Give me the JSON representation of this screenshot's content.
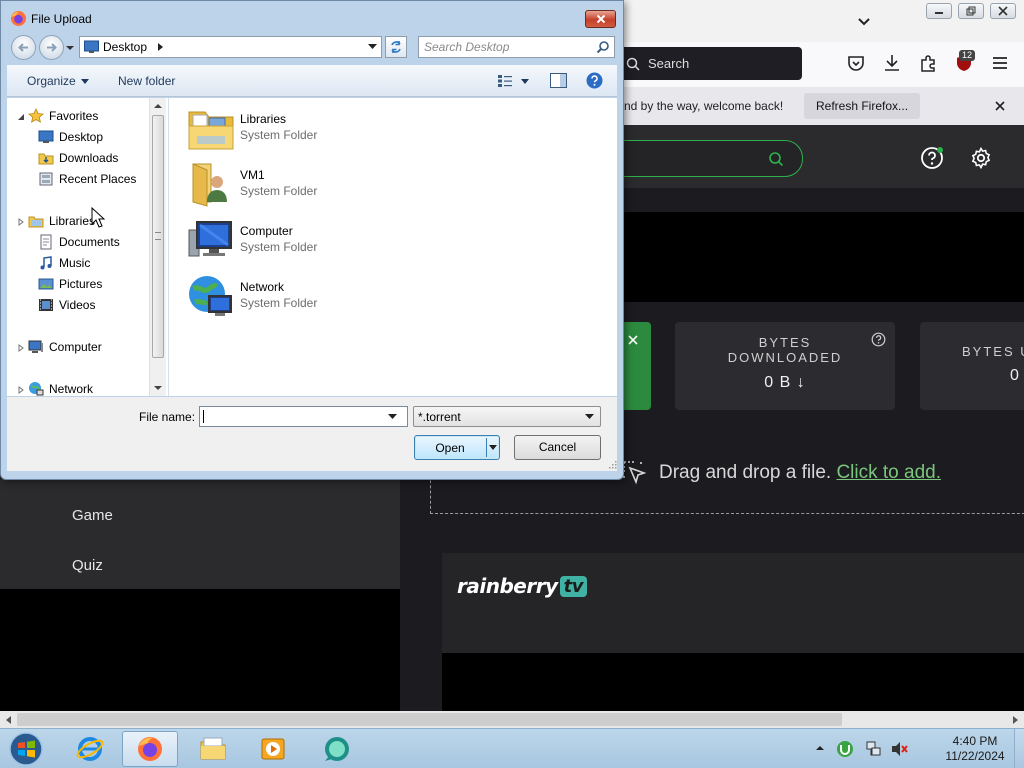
{
  "firefox": {
    "search_placeholder": "Search",
    "extension_badge": "12",
    "notification_text": "nd by the way, welcome back!",
    "refresh_button": "Refresh Firefox..."
  },
  "webpage": {
    "stats": {
      "downloaded_label": "BYTES DOWNLOADED",
      "downloaded_value": "0 B ↓",
      "uploaded_label": "BYTES U",
      "uploaded_value": "0"
    },
    "drop_text": "Drag and drop a file.",
    "drop_link": "Click to add.",
    "menu": [
      "Game",
      "Quiz"
    ],
    "logo_text": "rainberry",
    "logo_tv": "tv",
    "accent_green": "#2bb24c",
    "link_green": "#7bc67e"
  },
  "dialog": {
    "title": "File Upload",
    "address": {
      "location": "Desktop"
    },
    "search_placeholder": "Search Desktop",
    "toolbar": {
      "organize": "Organize",
      "new_folder": "New folder"
    },
    "nav_tree": {
      "favorites": "Favorites",
      "favorites_items": [
        "Desktop",
        "Downloads",
        "Recent Places"
      ],
      "libraries": "Libraries",
      "libraries_items": [
        "Documents",
        "Music",
        "Pictures",
        "Videos"
      ],
      "computer": "Computer",
      "network": "Network"
    },
    "files": [
      {
        "name": "Libraries",
        "type": "System Folder",
        "icon": "libraries-folder-icon"
      },
      {
        "name": "VM1",
        "type": "System Folder",
        "icon": "user-folder-icon"
      },
      {
        "name": "Computer",
        "type": "System Folder",
        "icon": "computer-icon"
      },
      {
        "name": "Network",
        "type": "System Folder",
        "icon": "network-globe-icon"
      }
    ],
    "file_name_label": "File name:",
    "file_name_value": "",
    "file_type": "*.torrent",
    "open_button": "Open",
    "cancel_button": "Cancel"
  },
  "taskbar": {
    "apps": [
      "internet-explorer",
      "firefox",
      "file-explorer",
      "media-player",
      "utorrent-web"
    ],
    "active_app": "firefox",
    "time": "4:40 PM",
    "date": "11/22/2024"
  }
}
